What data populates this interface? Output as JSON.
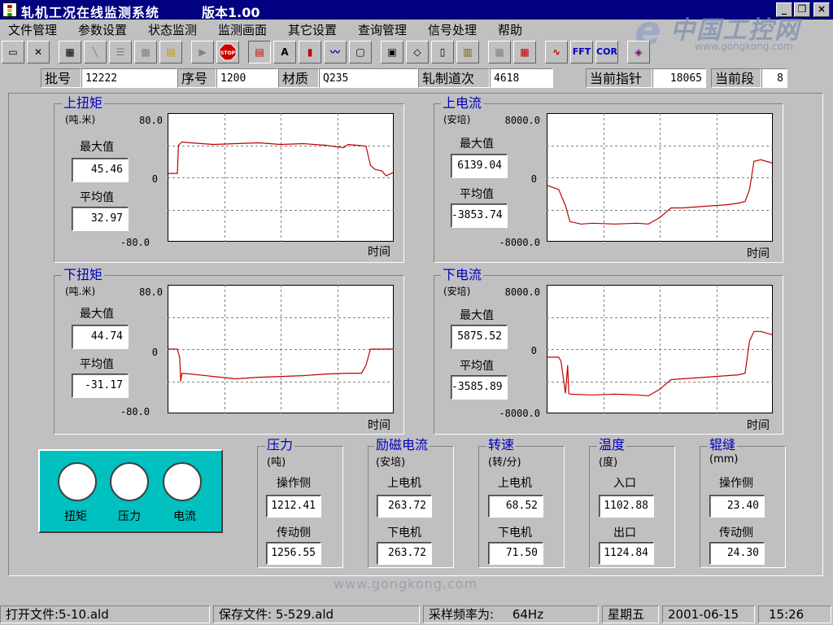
{
  "window": {
    "title": "轧机工况在线监测系统",
    "version": "版本1.00",
    "minimize": "_",
    "restore": "❐",
    "close": "×"
  },
  "watermark": {
    "text": "中国工控网",
    "url": "www.gongkong.com",
    "bottom": "www.gongkong.com"
  },
  "menu": [
    "文件管理",
    "参数设置",
    "状态监测",
    "监测画面",
    "其它设置",
    "查询管理",
    "信号处理",
    "帮助"
  ],
  "toolbar": {
    "fft": "FFT",
    "cor": "COR"
  },
  "info": {
    "batch_label": "批号",
    "batch_value": "12222",
    "seq_label": "序号",
    "seq_value": "1200",
    "material_label": "材质",
    "material_value": "Q235",
    "pass_label": "轧制道次",
    "pass_value": "4618",
    "pointer_label": "当前指针",
    "pointer_value": "18065",
    "segment_label": "当前段",
    "segment_value": "8"
  },
  "charts": {
    "upper_torque": {
      "title": "上扭矩",
      "unit": "(吨.米)",
      "max_label": "最大值",
      "max": "45.46",
      "avg_label": "平均值",
      "avg": "32.97",
      "ymax": "80.0",
      "yzero": "0",
      "ymin": "-80.0",
      "xlabel": "时间"
    },
    "upper_current": {
      "title": "上电流",
      "unit": "(安培)",
      "max_label": "最大值",
      "max": "6139.04",
      "avg_label": "平均值",
      "avg": "-3853.74",
      "ymax": "8000.0",
      "yzero": "0",
      "ymin": "-8000.0",
      "xlabel": "时间"
    },
    "lower_torque": {
      "title": "下扭矩",
      "unit": "(吨.米)",
      "max_label": "最大值",
      "max": "44.74",
      "avg_label": "平均值",
      "avg": "-31.17",
      "ymax": "80.0",
      "yzero": "0",
      "ymin": "-80.0",
      "xlabel": "时间"
    },
    "lower_current": {
      "title": "下电流",
      "unit": "(安培)",
      "max_label": "最大值",
      "max": "5875.52",
      "avg_label": "平均值",
      "avg": "-3585.89",
      "ymax": "8000.0",
      "yzero": "0",
      "ymin": "-8000.0",
      "xlabel": "时间"
    }
  },
  "chart_data": [
    {
      "type": "line",
      "ylim": [
        -80,
        80
      ],
      "color": "#c00000",
      "x": [
        0,
        0.04,
        0.045,
        0.06,
        0.1,
        0.2,
        0.3,
        0.4,
        0.5,
        0.6,
        0.7,
        0.78,
        0.8,
        0.84,
        0.88,
        0.9,
        0.92,
        0.95,
        0.97,
        1.0
      ],
      "y": [
        5,
        5,
        40,
        44,
        43,
        41,
        42,
        43,
        41,
        42,
        40,
        37,
        41,
        40,
        39,
        15,
        10,
        8,
        2,
        6
      ]
    },
    {
      "type": "line",
      "ylim": [
        -8000,
        8000
      ],
      "color": "#c00000",
      "x": [
        0,
        0.05,
        0.08,
        0.1,
        0.15,
        0.2,
        0.3,
        0.4,
        0.45,
        0.5,
        0.55,
        0.6,
        0.7,
        0.8,
        0.85,
        0.88,
        0.9,
        0.92,
        0.95,
        1.0
      ],
      "y": [
        -1000,
        -1500,
        -3500,
        -5500,
        -5800,
        -5700,
        -5800,
        -5700,
        -5800,
        -5000,
        -3800,
        -3800,
        -3600,
        -3400,
        -3200,
        -3000,
        -1500,
        2000,
        2200,
        1800
      ]
    },
    {
      "type": "line",
      "ylim": [
        -80,
        80
      ],
      "color": "#c00000",
      "x": [
        0,
        0.04,
        0.05,
        0.055,
        0.06,
        0.1,
        0.2,
        0.3,
        0.4,
        0.5,
        0.6,
        0.7,
        0.8,
        0.86,
        0.88,
        0.9,
        0.95,
        1.0
      ],
      "y": [
        0,
        0,
        -10,
        -40,
        -30,
        -31,
        -34,
        -37,
        -35,
        -34,
        -33,
        -31,
        -30,
        -30,
        -20,
        0,
        0,
        0
      ]
    },
    {
      "type": "line",
      "ylim": [
        -8000,
        8000
      ],
      "color": "#c00000",
      "x": [
        0,
        0.05,
        0.06,
        0.08,
        0.09,
        0.095,
        0.1,
        0.2,
        0.3,
        0.4,
        0.45,
        0.5,
        0.55,
        0.6,
        0.7,
        0.8,
        0.85,
        0.88,
        0.9,
        0.92,
        0.95,
        1.0
      ],
      "y": [
        -1000,
        -1000,
        -1500,
        -5500,
        -2000,
        -5500,
        -5600,
        -5700,
        -5600,
        -5700,
        -5800,
        -5000,
        -3800,
        -3700,
        -3500,
        -3300,
        -3200,
        -3000,
        1000,
        2200,
        2200,
        1800
      ]
    }
  ],
  "panels": {
    "pressure": {
      "title": "压力",
      "unit": "(吨)",
      "l1": "操作侧",
      "v1": "1212.41",
      "l2": "传动侧",
      "v2": "1256.55"
    },
    "excitation": {
      "title": "励磁电流",
      "unit": "(安培)",
      "l1": "上电机",
      "v1": "263.72",
      "l2": "下电机",
      "v2": "263.72"
    },
    "speed": {
      "title": "转速",
      "unit": "(转/分)",
      "l1": "上电机",
      "v1": "68.52",
      "l2": "下电机",
      "v2": "71.50"
    },
    "temperature": {
      "title": "温度",
      "unit": "(度)",
      "l1": "入口",
      "v1": "1102.88",
      "l2": "出口",
      "v2": "1124.84"
    },
    "gap": {
      "title": "辊缝",
      "unit": "(mm)",
      "l1": "操作侧",
      "v1": "23.40",
      "l2": "传动侧",
      "v2": "24.30"
    }
  },
  "indicators": {
    "torque": "扭矩",
    "pressure": "压力",
    "current": "电流"
  },
  "status": {
    "open_file": "打开文件:5-10.ald",
    "save_file": "保存文件: 5-529.ald",
    "sample_rate_label": "采样频率为:",
    "sample_rate": "64Hz",
    "weekday": "星期五",
    "date": "2001-06-15",
    "time": "15:26"
  }
}
